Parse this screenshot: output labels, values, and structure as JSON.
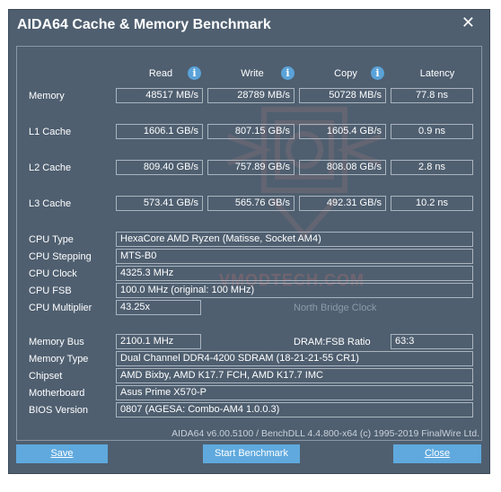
{
  "window": {
    "title": "AIDA64 Cache & Memory Benchmark",
    "close_glyph": "✕"
  },
  "columns": {
    "read": "Read",
    "write": "Write",
    "copy": "Copy",
    "latency": "Latency",
    "info_glyph": "i"
  },
  "rows": [
    {
      "label": "Memory",
      "read": "48517 MB/s",
      "write": "28789 MB/s",
      "copy": "50728 MB/s",
      "latency": "77.8 ns"
    },
    {
      "label": "L1 Cache",
      "read": "1606.1 GB/s",
      "write": "807.15 GB/s",
      "copy": "1605.4 GB/s",
      "latency": "0.9 ns"
    },
    {
      "label": "L2 Cache",
      "read": "809.40 GB/s",
      "write": "757.89 GB/s",
      "copy": "808.08 GB/s",
      "latency": "2.8 ns"
    },
    {
      "label": "L3 Cache",
      "read": "573.41 GB/s",
      "write": "565.76 GB/s",
      "copy": "492.31 GB/s",
      "latency": "10.2 ns"
    }
  ],
  "cpu": {
    "type_label": "CPU Type",
    "type": "HexaCore AMD Ryzen  (Matisse, Socket AM4)",
    "stepping_label": "CPU Stepping",
    "stepping": "MTS-B0",
    "clock_label": "CPU Clock",
    "clock": "4325.3 MHz",
    "fsb_label": "CPU FSB",
    "fsb": "100.0 MHz  (original: 100 MHz)",
    "multiplier_label": "CPU Multiplier",
    "multiplier": "43.25x",
    "nb_clock_label": "North Bridge Clock"
  },
  "memory": {
    "bus_label": "Memory Bus",
    "bus": "2100.1 MHz",
    "ratio_label": "DRAM:FSB Ratio",
    "ratio": "63:3",
    "type_label": "Memory Type",
    "type": "Dual Channel DDR4-4200 SDRAM  (18-21-21-55 CR1)",
    "chipset_label": "Chipset",
    "chipset": "AMD Bixby, AMD K17.7 FCH, AMD K17.7 IMC",
    "motherboard_label": "Motherboard",
    "motherboard": "Asus Prime X570-P",
    "bios_label": "BIOS Version",
    "bios": "0807  (AGESA: Combo-AM4 1.0.0.3)"
  },
  "footer": "AIDA64 v6.00.5100 / BenchDLL 4.4.800-x64  (c) 1995-2019 FinalWire Ltd.",
  "buttons": {
    "save": "Save",
    "start": "Start Benchmark",
    "close": "Close"
  },
  "watermark": "VMODTECH.COM"
}
